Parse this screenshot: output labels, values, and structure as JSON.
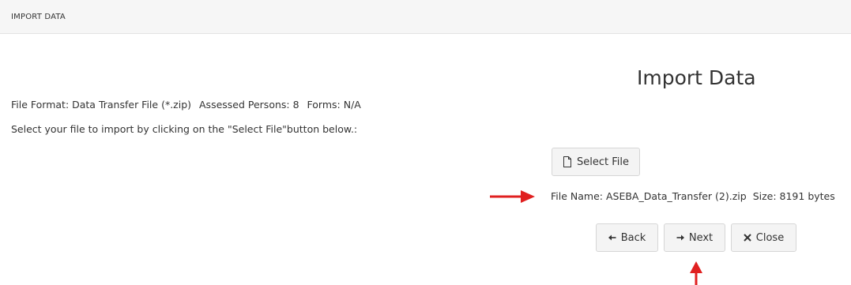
{
  "header": {
    "title": "IMPORT DATA"
  },
  "main": {
    "page_title": "Import Data",
    "file_format": "File Format: Data Transfer File (*.zip)",
    "assessed_persons": "Assessed Persons: 8",
    "forms": "Forms: N/A",
    "instruction": "Select your file to import by clicking on the \"Select File\"button below.:",
    "select_file_label": "Select File",
    "file_name": "File Name: ASEBA_Data_Transfer (2).zip",
    "file_size": "Size: 8191 bytes",
    "buttons": {
      "back_label": "Back",
      "next_label": "Next",
      "close_label": "Close"
    }
  },
  "icons": {
    "select_file": "file-icon",
    "back": "arrow-left-icon",
    "next": "arrow-right-icon",
    "close": "close-icon"
  },
  "colors": {
    "annotation_arrow": "#e02020"
  }
}
